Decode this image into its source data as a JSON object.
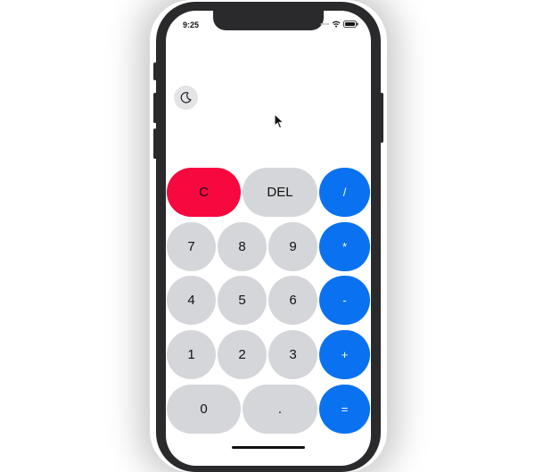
{
  "status_bar": {
    "time": "9:25",
    "icons": [
      "signal-dots-icon",
      "wifi-icon",
      "battery-icon"
    ]
  },
  "theme_toggle": {
    "icon": "moon-icon"
  },
  "display": {
    "value": ""
  },
  "keys": {
    "clear": "C",
    "delete": "DEL",
    "divide": "/",
    "seven": "7",
    "eight": "8",
    "nine": "9",
    "multiply": "*",
    "four": "4",
    "five": "5",
    "six": "6",
    "subtract": "-",
    "one": "1",
    "two": "2",
    "three": "3",
    "add": "+",
    "zero": "0",
    "decimal": ".",
    "equals": "="
  },
  "colors": {
    "operator": "#0a72f0",
    "clear": "#f7083f",
    "number": "#d5d6da"
  }
}
